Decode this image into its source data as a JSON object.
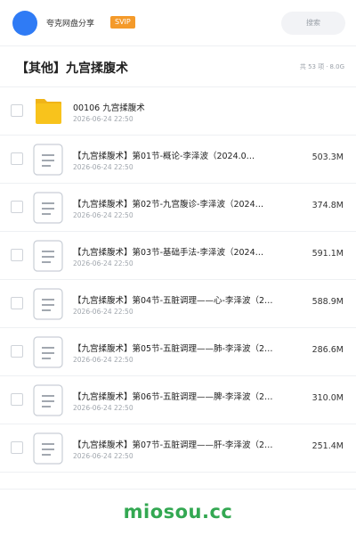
{
  "header": {
    "user_name": "夸克网盘分享",
    "badge": "SVIP",
    "search_placeholder": "搜索"
  },
  "folder": {
    "title": "【其他】九宫揉腹术",
    "count": "共 53 项",
    "separator": "·",
    "size": "8.0G"
  },
  "files": [
    {
      "name": "00106 九宫揉腹术",
      "date": "2026-06-24 22:50",
      "size": "",
      "icon": "folder-icon"
    },
    {
      "name": "【九宫揉腹术】第01节-概论-李泽波（2024.0…",
      "date": "2026-06-24 22:50",
      "size": "503.3M",
      "icon": "video-file-icon"
    },
    {
      "name": "【九宫揉腹术】第02节-九宫腹诊-李泽波（2024…",
      "date": "2026-06-24 22:50",
      "size": "374.8M",
      "icon": "video-file-icon"
    },
    {
      "name": "【九宫揉腹术】第03节-基础手法-李泽波（2024…",
      "date": "2026-06-24 22:50",
      "size": "591.1M",
      "icon": "video-file-icon"
    },
    {
      "name": "【九宫揉腹术】第04节-五脏调理——心-李泽波（2…",
      "date": "2026-06-24 22:50",
      "size": "588.9M",
      "icon": "video-file-icon"
    },
    {
      "name": "【九宫揉腹术】第05节-五脏调理——肺-李泽波（2…",
      "date": "2026-06-24 22:50",
      "size": "286.6M",
      "icon": "video-file-icon"
    },
    {
      "name": "【九宫揉腹术】第06节-五脏调理——脾-李泽波（2…",
      "date": "2026-06-24 22:50",
      "size": "310.0M",
      "icon": "video-file-icon"
    },
    {
      "name": "【九宫揉腹术】第07节-五脏调理——肝-李泽波（2…",
      "date": "2026-06-24 22:50",
      "size": "251.4M",
      "icon": "video-file-icon"
    }
  ],
  "watermark": "miosou.cc",
  "colors": {
    "accent": "#2f7bf5",
    "badge": "#f49a2a",
    "folder": "#f8c31c",
    "watermark": "#33a852"
  }
}
